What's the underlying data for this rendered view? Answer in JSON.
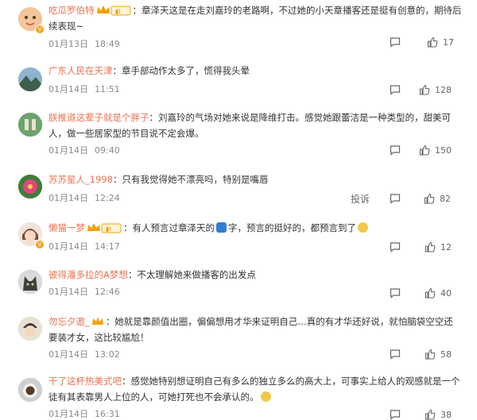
{
  "comments": [
    {
      "user": "吃瓜罗伯特",
      "text": "：章泽天这是在走刘嘉玲的老路啊，不过她的小天章播客还是挺有创意的，期待后续表现~",
      "date": "01月13日",
      "time": "18:49",
      "likes": "17",
      "crown": true,
      "vip": true,
      "avatar_color": "#f2b38a"
    },
    {
      "user": "广东人民在天津",
      "text": "：章手部动作太多了，慌得我头晕",
      "date": "01月14日",
      "time": "11:51",
      "likes": "128",
      "crown": false,
      "vip": false,
      "avatar_color": "#5d7f9c"
    },
    {
      "user": "朕推道这辈子就是个胖子",
      "text": "：刘嘉玲的气场对她来说是降维打击。感觉她跟蕾洁是一种类型的，甜美可人，做一些居家型的节目说不定会爆。",
      "date": "01月14日",
      "time": "09:40",
      "likes": "150",
      "crown": false,
      "vip": false,
      "avatar_color": "#4f8f5a"
    },
    {
      "user": "苏苏星人_1998",
      "text": "：只有我觉得她不漂亮吗，特别是嘴唇",
      "date": "01月14日",
      "time": "12:24",
      "likes": "82",
      "crown": false,
      "vip": false,
      "avatar_color": "#d4477a",
      "report": "投诉"
    },
    {
      "user": "懒猫一梦",
      "text_before": "：有人预言过章泽天的",
      "text_after": "字，预言的挺好的，都预言到了",
      "date": "01月14日",
      "time": "14:17",
      "likes": "12",
      "crown": true,
      "vip": true,
      "avatar_color": "#e8cdbf"
    },
    {
      "user": "彼得潘多拉的A梦想",
      "text": "：不太理解她来做播客的出发点",
      "date": "01月14日",
      "time": "12:46",
      "likes": "40",
      "crown": false,
      "vip": false,
      "avatar_color": "#7a7a7a"
    },
    {
      "user": "勿忘夕邀_",
      "text": "：她就是靠颜值出圈，偏偏想用才华来证明自己…真的有才华还好说，就怕脑袋空空还要装才女，这比较尴尬！",
      "date": "01月14日",
      "time": "13:02",
      "likes": "58",
      "crown": true,
      "vip": false,
      "avatar_color": "#c8b9a4"
    },
    {
      "user": "干了这杯热美式吧",
      "text": "：感觉她特别想证明自己有多么的独立多么的高大上，可事实上给人的观感就是一个徒有其表靠男人上位的人，可她打死也不会承认的。",
      "date": "01月14日",
      "time": "16:31",
      "likes": "38",
      "crown": false,
      "vip": false,
      "avatar_color": "#9a9a9a"
    }
  ],
  "colors": {
    "username": "#eb7350",
    "meta": "#8a8a8a",
    "crown": "#f0a30a"
  }
}
